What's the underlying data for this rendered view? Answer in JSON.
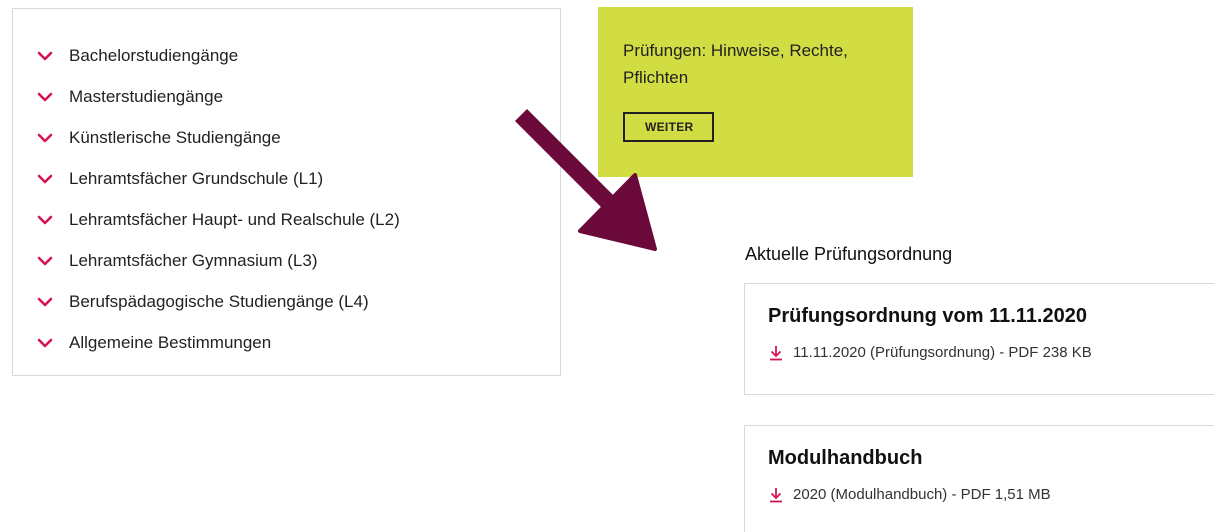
{
  "accordion": {
    "items": [
      {
        "label": "Bachelorstudiengänge"
      },
      {
        "label": "Masterstudiengänge"
      },
      {
        "label": "Künstlerische Studiengänge"
      },
      {
        "label": "Lehramtsfächer Grundschule (L1)"
      },
      {
        "label": "Lehramtsfächer Haupt- und Realschule (L2)"
      },
      {
        "label": "Lehramtsfächer Gymnasium (L3)"
      },
      {
        "label": "Berufspädagogische Studiengänge (L4)"
      },
      {
        "label": "Allgemeine Bestimmungen"
      }
    ],
    "chevron_icon": "chevron-down-icon",
    "accent_color": "#d4145a"
  },
  "teaser": {
    "title": "Prüfungen: Hinweise, Rechte, Pflichten",
    "button_label": "WEITER",
    "background_color": "#d2dc43"
  },
  "arrow": {
    "icon": "arrow-down-right-icon",
    "color": "#6b0a3a"
  },
  "documents": {
    "section_title": "Aktuelle Prüfungsordnung",
    "cards": [
      {
        "title": "Prüfungsordnung vom 11.11.2020",
        "link_text": "11.11.2020 (Prüfungsordnung) - PDF 238 KB",
        "icon": "download-icon"
      },
      {
        "title": "Modulhandbuch",
        "link_text": "2020 (Modulhandbuch) - PDF 1,51 MB",
        "icon": "download-icon"
      }
    ]
  }
}
